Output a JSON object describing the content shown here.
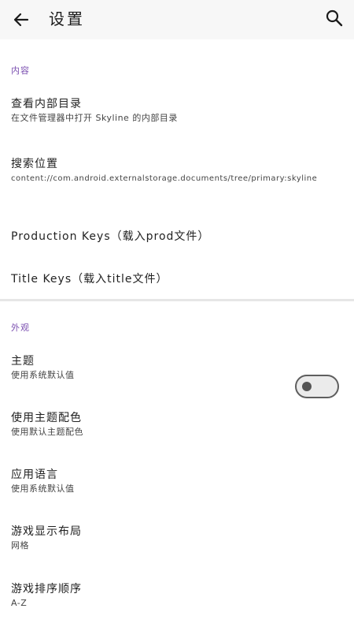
{
  "appbar": {
    "title": "设置",
    "back_icon": "arrow-back-icon",
    "search_icon": "search-icon"
  },
  "sections": {
    "content": {
      "header": "内容",
      "items": [
        {
          "title": "查看内部目录",
          "subtitle": "在文件管理器中打开 Skyline 的内部目录"
        },
        {
          "title": "搜索位置",
          "subtitle": "content://com.android.externalstorage.documents/tree/primary:skyline"
        },
        {
          "title": "Production Keys（载入prod文件）"
        },
        {
          "title": "Title Keys（载入title文件）"
        }
      ]
    },
    "appearance": {
      "header": "外观",
      "items": [
        {
          "title": "主题",
          "subtitle": "使用系统默认值"
        },
        {
          "title": "使用主题配色",
          "subtitle": "使用默认主题配色",
          "toggle": "off"
        },
        {
          "title": "应用语言",
          "subtitle": "使用系统默认值"
        },
        {
          "title": "游戏显示布局",
          "subtitle": "网格"
        },
        {
          "title": "游戏排序顺序",
          "subtitle": "A-Z"
        }
      ]
    }
  },
  "colors": {
    "accent": "#7b4fb0",
    "appbar_bg": "#f7f7f7",
    "divider": "#e6e6e6"
  }
}
